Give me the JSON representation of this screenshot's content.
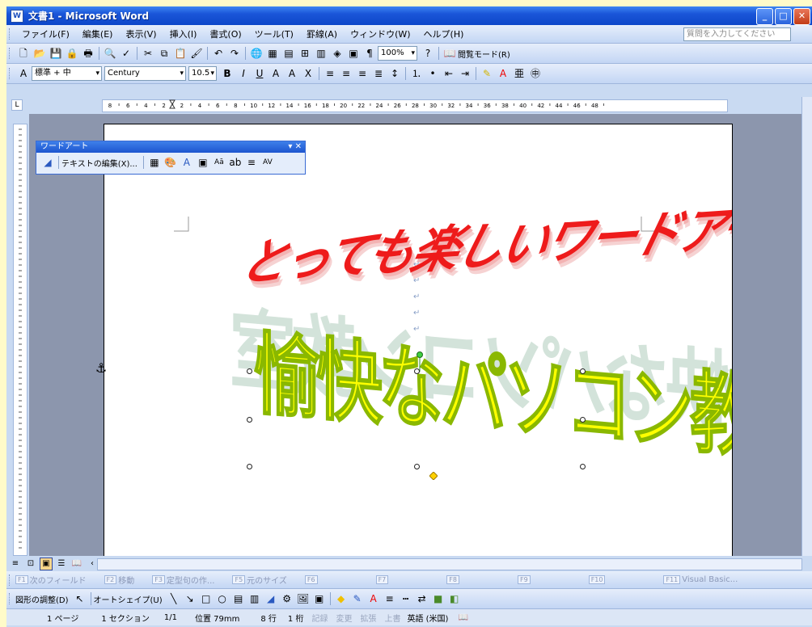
{
  "window": {
    "title": "文書1 - Microsoft Word",
    "icon_text": "W"
  },
  "menu": {
    "items": [
      "ファイル(F)",
      "編集(E)",
      "表示(V)",
      "挿入(I)",
      "書式(O)",
      "ツール(T)",
      "罫線(A)",
      "ウィンドウ(W)",
      "ヘルプ(H)"
    ],
    "help_placeholder": "質問を入力してください"
  },
  "standard_toolbar": {
    "zoom": "100%",
    "reading_mode": "閲覧モード(R)"
  },
  "format_toolbar": {
    "style": "標準 + 中",
    "font": "Century",
    "size": "10.5"
  },
  "ruler": {
    "h_ticks": [
      "8",
      "6",
      "4",
      "2",
      "2",
      "4",
      "6",
      "8",
      "10",
      "12",
      "14",
      "16",
      "18",
      "20",
      "22",
      "24",
      "26",
      "28",
      "30",
      "32",
      "34",
      "36",
      "38",
      "40",
      "42",
      "44",
      "46",
      "48"
    ]
  },
  "wordart_toolbar": {
    "title": "ワードアート",
    "edit_text": "テキストの編集(X)..."
  },
  "document": {
    "wordart1": "とっても楽しいワードアート",
    "wordart2": "愉快なパソコン教室"
  },
  "function_keys": [
    {
      "key": "F1",
      "label": "次のフィールド"
    },
    {
      "key": "F2",
      "label": "移動"
    },
    {
      "key": "F3",
      "label": "定型句の作..."
    },
    {
      "key": "F5",
      "label": "元のサイズ"
    },
    {
      "key": "F6",
      "label": ""
    },
    {
      "key": "F7",
      "label": ""
    },
    {
      "key": "F8",
      "label": ""
    },
    {
      "key": "F9",
      "label": ""
    },
    {
      "key": "F10",
      "label": ""
    },
    {
      "key": "F11",
      "label": "Visual Basic..."
    }
  ],
  "drawing_toolbar": {
    "adjust": "図形の調整(D)",
    "autoshape": "オートシェイプ(U)"
  },
  "statusbar": {
    "page": "1 ページ",
    "section": "1 セクション",
    "pages": "1/1",
    "position": "位置 79mm",
    "line": "8 行",
    "column": "1 桁",
    "rec": "記録",
    "trk": "変更",
    "ext": "拡張",
    "ovr": "上書",
    "language": "英語 (米国)"
  },
  "colors": {
    "wordart1": "#ee1b1b",
    "wordart2": "#ffff00",
    "title_bar": "#1a55d8"
  }
}
